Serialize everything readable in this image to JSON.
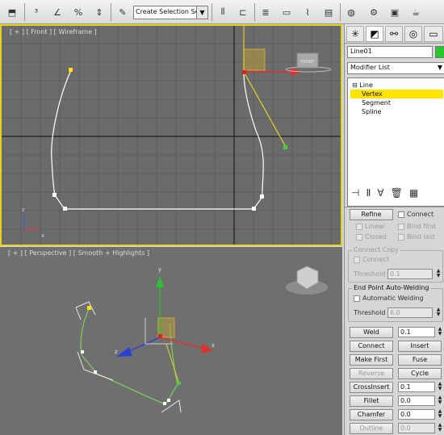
{
  "toolbar": {
    "selection_set_placeholder": "Create Selection Se",
    "icons": [
      "select-icon",
      "snap-3d-icon",
      "angle-snap-icon",
      "percent-snap-icon",
      "spinner-snap-icon",
      "edit-named-selection-icon",
      "named-selection-combo",
      "mirror-icon",
      "align-icon",
      "layer-manager-icon",
      "graphite-ribbon-icon",
      "curve-editor-icon",
      "schematic-view-icon",
      "material-editor-icon",
      "render-setup-icon",
      "rendered-frame-icon",
      "render-icon"
    ]
  },
  "viewports": {
    "front_label": "[ + ] [ Front ] [ Wireframe ]",
    "perspective_label": "[ + ] [ Perspective ] [ Smooth + Highlights ]",
    "viewcube_front_text": "FRONT"
  },
  "command_panel": {
    "object_name": "Line01",
    "object_color": "#28c828",
    "modifier_list_label": "Modifier List",
    "stack": [
      {
        "label": "Line",
        "level": 0,
        "selected": false
      },
      {
        "label": "Vertex",
        "level": 1,
        "selected": true
      },
      {
        "label": "Segment",
        "level": 1,
        "selected": false
      },
      {
        "label": "Spline",
        "level": 1,
        "selected": false
      }
    ],
    "rollout": {
      "refine": "Refine",
      "connect": "Connect",
      "linear": "Linear",
      "bind_first": "Bind first",
      "closed": "Closed",
      "bind_last": "Bind last",
      "connect_copy_title": "Connect Copy",
      "connect_copy_cb": "Connect",
      "threshold_label": "Threshold",
      "threshold_value_1": "0.1",
      "end_point_title": "End Point Auto-Welding",
      "automatic_welding": "Automatic Welding",
      "threshold_value_2": "6.0",
      "weld": "Weld",
      "weld_value": "0.1",
      "connect_btn": "Connect",
      "insert": "Insert",
      "make_first": "Make First",
      "fuse": "Fuse",
      "reverse": "Reverse",
      "cycle": "Cycle",
      "cross_insert": "CrossInsert",
      "cross_insert_value": "0.1",
      "fillet": "Fillet",
      "fillet_value": "0.0",
      "chamfer": "Chamfer",
      "chamfer_value": "0.0",
      "outline": "Outline",
      "outline_value": "0.0"
    }
  },
  "colors": {
    "active_viewport_border": "#e6d21e",
    "selected_subobject": "#ffe400",
    "spline_front": "#ffffff",
    "spline_persp": "#7fcf5a"
  }
}
